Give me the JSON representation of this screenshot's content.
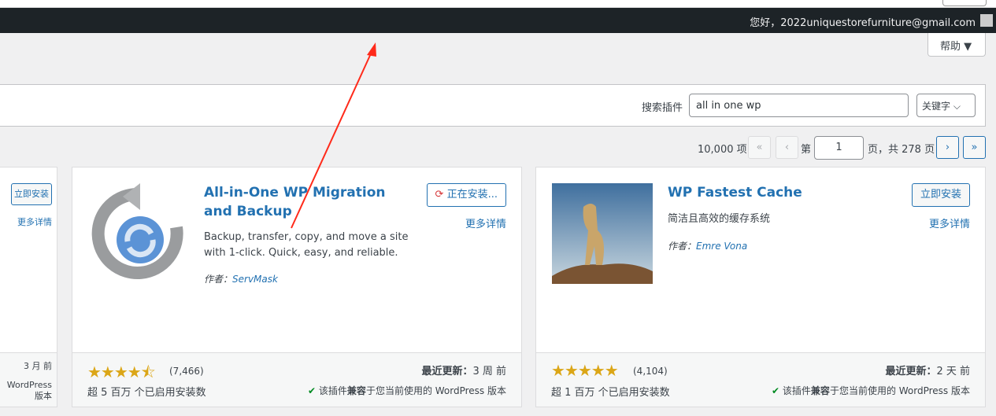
{
  "admin_bar": {
    "greeting": "您好，2022uniquestorefurniture@gmail.com"
  },
  "help": {
    "label": "帮助 ▼"
  },
  "search": {
    "label": "搜索插件",
    "value": "all in one wp",
    "type_select": "关键字"
  },
  "pagination": {
    "total_items": "10,000 项",
    "first": "«",
    "prev": "‹",
    "prefix": "第",
    "current_page": "1",
    "suffix": "页，共 278 页",
    "next": "›",
    "last": "»"
  },
  "cards": [
    {
      "install": "立即安装",
      "more": "更多详情",
      "updated_value": "3 月 前",
      "compat": "WordPress 版本"
    },
    {
      "title": "All-in-One WP Migration and Backup",
      "description": "Backup, transfer, copy, and move a site with 1-click. Quick, easy, and reliable.",
      "author_label": "作者：",
      "author": "ServMask",
      "install": "正在安装...",
      "more": "更多详情",
      "rating": 4.5,
      "stars": "★★★★⯪",
      "rating_count": "(7,466)",
      "updated_label": "最近更新：",
      "updated_value": "3 周 前",
      "installs": "超 5 百万 个已启用安装数",
      "compat_prefix": "该插件",
      "compat_bold": "兼容",
      "compat_suffix": "于您当前使用的 WordPress 版本"
    },
    {
      "title": "WP Fastest Cache",
      "description": "简洁且高效的缓存系统",
      "author_label": "作者：",
      "author": "Emre Vona",
      "install": "立即安装",
      "more": "更多详情",
      "rating": 5,
      "stars": "★★★★★",
      "rating_count": "(4,104)",
      "updated_label": "最近更新：",
      "updated_value": "2 天 前",
      "installs": "超 1 百万 个已启用安装数",
      "compat_prefix": "该插件",
      "compat_bold": "兼容",
      "compat_suffix": "于您当前使用的 WordPress 版本"
    }
  ],
  "colors": {
    "accent": "#2271b1",
    "adminbar": "#1d2327",
    "star": "#dba617",
    "annotation_arrow": "#ff2a1a"
  }
}
